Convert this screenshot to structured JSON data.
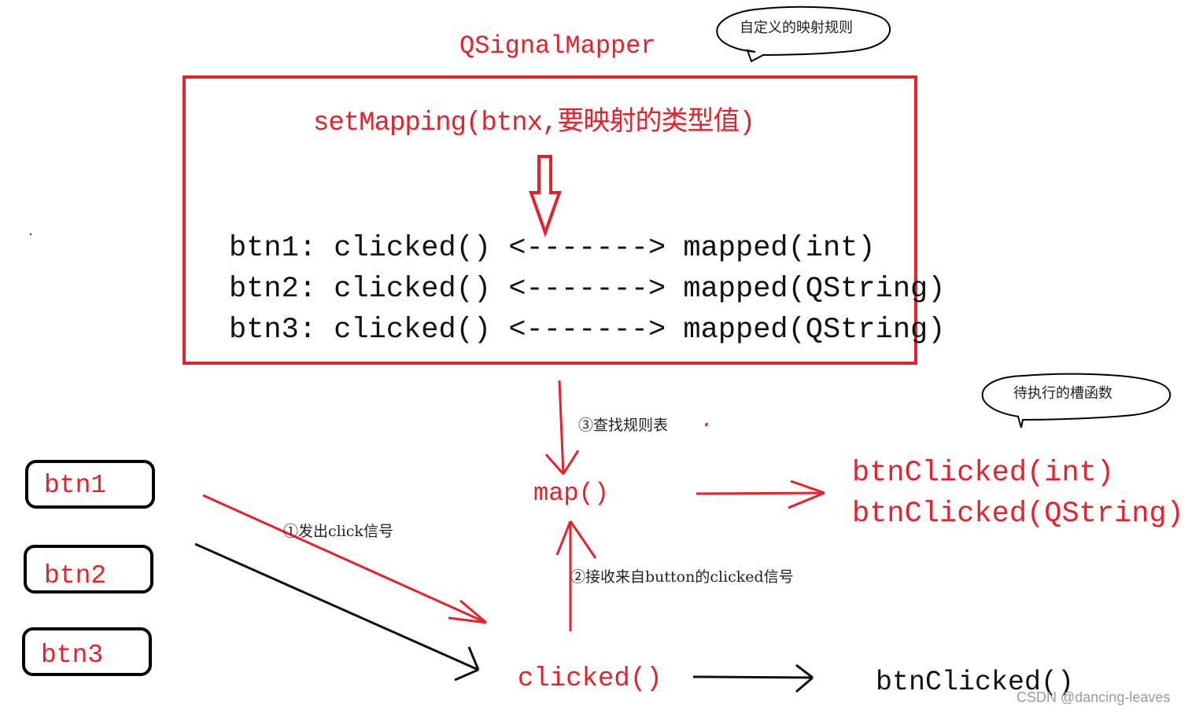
{
  "diagram": {
    "title": "QSignalMapper",
    "bubble_top": "自定义的映射规则",
    "bubble_right": "待执行的槽函数",
    "mapper_box": {
      "set_mapping": "setMapping(btnx,要映射的类型值)",
      "rules": [
        {
          "sender": "btn1:",
          "signal": "clicked()",
          "arrow": "<------->",
          "mapped": "mapped(int)"
        },
        {
          "sender": "btn2:",
          "signal": "clicked()",
          "arrow": "<------->",
          "mapped": "mapped(QString)"
        },
        {
          "sender": "btn3:",
          "signal": "clicked()",
          "arrow": "<------->",
          "mapped": "mapped(QString)"
        }
      ]
    },
    "buttons": [
      "btn1",
      "btn2",
      "btn3"
    ],
    "map_fn": "map()",
    "clicked_fn": "clicked()",
    "slots": [
      "btnClicked(int)",
      "btnClicked(QString)"
    ],
    "plain_slot": "btnClicked()",
    "steps": {
      "step1": "①发出click信号",
      "step2": "②接收来自button的clicked信号",
      "step3": "③查找规则表"
    },
    "watermark": "CSDN @dancing-leaves",
    "colors": {
      "red": "#e8202a",
      "black": "#111111"
    }
  }
}
